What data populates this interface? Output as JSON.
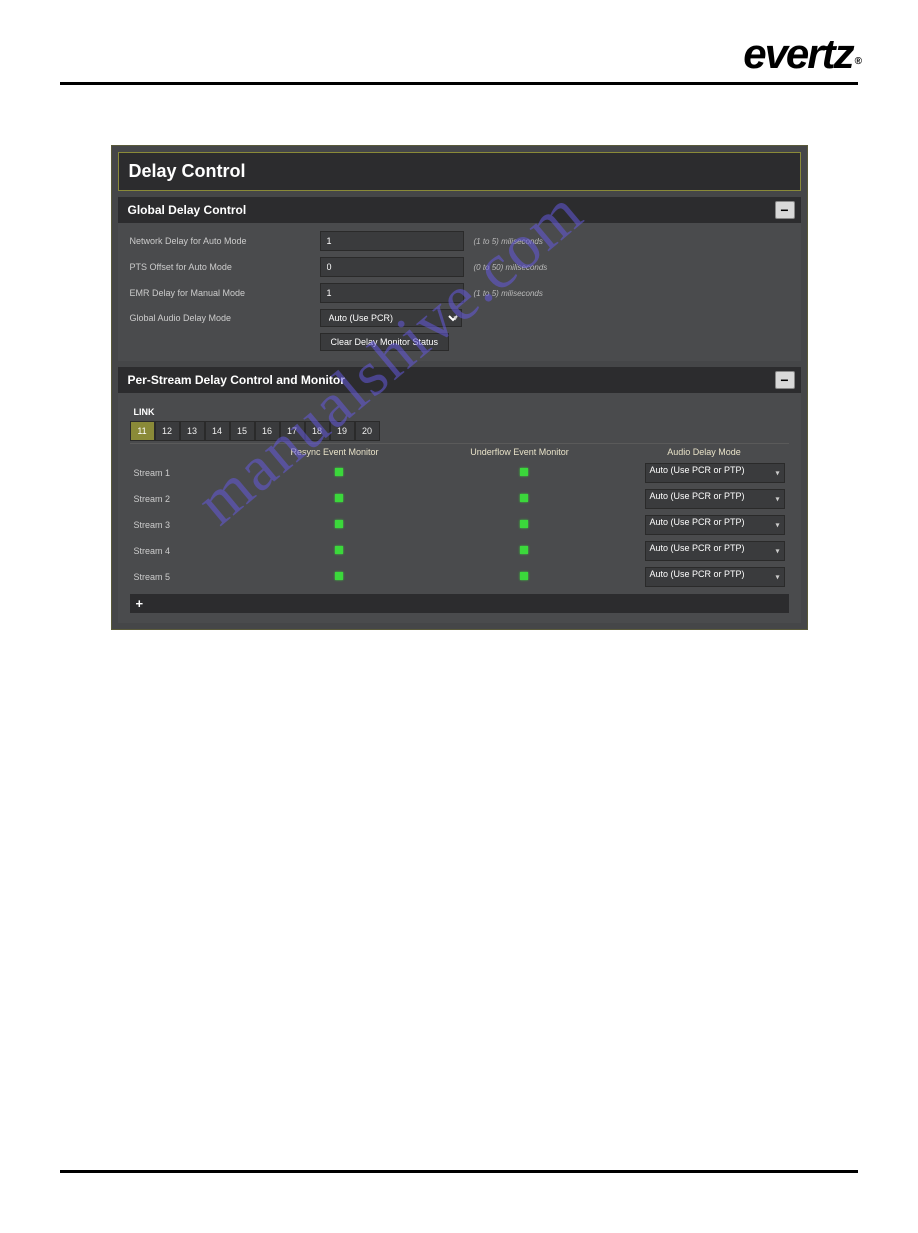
{
  "brand": "evertz",
  "watermark": "manualshive.com",
  "page": {
    "title": "Delay Control"
  },
  "global": {
    "heading": "Global Delay Control",
    "rows": [
      {
        "label": "Network Delay for Auto Mode",
        "value": "1",
        "hint": "(1 to 5) miliseconds"
      },
      {
        "label": "PTS Offset for Auto Mode",
        "value": "0",
        "hint": "(0 to 50) miliseconds"
      },
      {
        "label": "EMR Delay for Manual Mode",
        "value": "1",
        "hint": "(1 to 5) miliseconds"
      }
    ],
    "mode_label": "Global Audio Delay Mode",
    "mode_value": "Auto (Use PCR)",
    "clear_button": "Clear Delay Monitor Status"
  },
  "perstream": {
    "heading": "Per-Stream Delay Control and Monitor",
    "link_label": "LINK",
    "tabs": [
      "11",
      "12",
      "13",
      "14",
      "15",
      "16",
      "17",
      "18",
      "19",
      "20"
    ],
    "active_tab": "11",
    "columns": {
      "resync": "Resync Event Monitor",
      "underflow": "Underflow Event Monitor",
      "mode": "Audio Delay Mode"
    },
    "rows": [
      {
        "name": "Stream 1",
        "mode": "Auto (Use PCR or PTP)"
      },
      {
        "name": "Stream 2",
        "mode": "Auto (Use PCR or PTP)"
      },
      {
        "name": "Stream 3",
        "mode": "Auto (Use PCR or PTP)"
      },
      {
        "name": "Stream 4",
        "mode": "Auto (Use PCR or PTP)"
      },
      {
        "name": "Stream 5",
        "mode": "Auto (Use PCR or PTP)"
      }
    ],
    "add_label": "+"
  }
}
